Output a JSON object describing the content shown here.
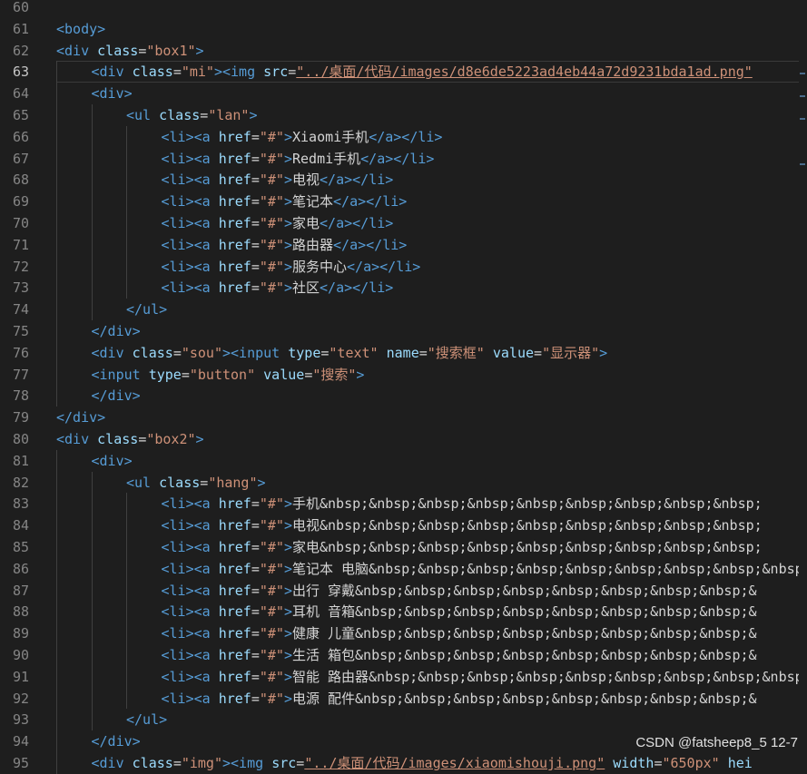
{
  "editor": {
    "first_line_number": 60,
    "current_line_number": 63,
    "lines": [
      {
        "n": "60",
        "indent": 0,
        "tokens": []
      },
      {
        "n": "61",
        "indent": 0,
        "tokens": [
          [
            "tag",
            "<body>"
          ]
        ]
      },
      {
        "n": "62",
        "indent": 0,
        "tokens": [
          [
            "tag",
            "<div "
          ],
          [
            "attr",
            "class"
          ],
          [
            "text",
            "="
          ],
          [
            "str",
            "\"box1\""
          ],
          [
            "tag",
            ">"
          ]
        ]
      },
      {
        "n": "63",
        "indent": 1,
        "tokens": [
          [
            "tag",
            "<div "
          ],
          [
            "attr",
            "class"
          ],
          [
            "text",
            "="
          ],
          [
            "str",
            "\"mi\""
          ],
          [
            "tag",
            "><img "
          ],
          [
            "attr",
            "src"
          ],
          [
            "text",
            "="
          ],
          [
            "link",
            "\"../桌面/代码/images/d8e6de5223ad4eb44a72d9231bda1ad.png\""
          ]
        ]
      },
      {
        "n": "64",
        "indent": 1,
        "tokens": [
          [
            "tag",
            "<div>"
          ]
        ]
      },
      {
        "n": "65",
        "indent": 2,
        "tokens": [
          [
            "tag",
            "<ul "
          ],
          [
            "attr",
            "class"
          ],
          [
            "text",
            "="
          ],
          [
            "str",
            "\"lan\""
          ],
          [
            "tag",
            ">"
          ]
        ]
      },
      {
        "n": "66",
        "indent": 3,
        "tokens": [
          [
            "tag",
            "<li><a "
          ],
          [
            "attr",
            "href"
          ],
          [
            "text",
            "="
          ],
          [
            "str",
            "\"#\""
          ],
          [
            "tag",
            ">"
          ],
          [
            "text",
            "Xiaomi手机"
          ],
          [
            "tag",
            "</a></li>"
          ]
        ]
      },
      {
        "n": "67",
        "indent": 3,
        "tokens": [
          [
            "tag",
            "<li><a "
          ],
          [
            "attr",
            "href"
          ],
          [
            "text",
            "="
          ],
          [
            "str",
            "\"#\""
          ],
          [
            "tag",
            ">"
          ],
          [
            "text",
            "Redmi手机"
          ],
          [
            "tag",
            "</a></li>"
          ]
        ]
      },
      {
        "n": "68",
        "indent": 3,
        "tokens": [
          [
            "tag",
            "<li><a "
          ],
          [
            "attr",
            "href"
          ],
          [
            "text",
            "="
          ],
          [
            "str",
            "\"#\""
          ],
          [
            "tag",
            ">"
          ],
          [
            "text",
            "电视"
          ],
          [
            "tag",
            "</a></li>"
          ]
        ]
      },
      {
        "n": "69",
        "indent": 3,
        "tokens": [
          [
            "tag",
            "<li><a "
          ],
          [
            "attr",
            "href"
          ],
          [
            "text",
            "="
          ],
          [
            "str",
            "\"#\""
          ],
          [
            "tag",
            ">"
          ],
          [
            "text",
            "笔记本"
          ],
          [
            "tag",
            "</a></li>"
          ]
        ]
      },
      {
        "n": "70",
        "indent": 3,
        "tokens": [
          [
            "tag",
            "<li><a "
          ],
          [
            "attr",
            "href"
          ],
          [
            "text",
            "="
          ],
          [
            "str",
            "\"#\""
          ],
          [
            "tag",
            ">"
          ],
          [
            "text",
            "家电"
          ],
          [
            "tag",
            "</a></li>"
          ]
        ]
      },
      {
        "n": "71",
        "indent": 3,
        "tokens": [
          [
            "tag",
            "<li><a "
          ],
          [
            "attr",
            "href"
          ],
          [
            "text",
            "="
          ],
          [
            "str",
            "\"#\""
          ],
          [
            "tag",
            ">"
          ],
          [
            "text",
            "路由器"
          ],
          [
            "tag",
            "</a></li>"
          ]
        ]
      },
      {
        "n": "72",
        "indent": 3,
        "tokens": [
          [
            "tag",
            "<li><a "
          ],
          [
            "attr",
            "href"
          ],
          [
            "text",
            "="
          ],
          [
            "str",
            "\"#\""
          ],
          [
            "tag",
            ">"
          ],
          [
            "text",
            "服务中心"
          ],
          [
            "tag",
            "</a></li>"
          ]
        ]
      },
      {
        "n": "73",
        "indent": 3,
        "tokens": [
          [
            "tag",
            "<li><a "
          ],
          [
            "attr",
            "href"
          ],
          [
            "text",
            "="
          ],
          [
            "str",
            "\"#\""
          ],
          [
            "tag",
            ">"
          ],
          [
            "text",
            "社区"
          ],
          [
            "tag",
            "</a></li>"
          ]
        ]
      },
      {
        "n": "74",
        "indent": 2,
        "tokens": [
          [
            "tag",
            "</ul>"
          ]
        ]
      },
      {
        "n": "75",
        "indent": 1,
        "tokens": [
          [
            "tag",
            "</div>"
          ]
        ]
      },
      {
        "n": "76",
        "indent": 1,
        "tokens": [
          [
            "tag",
            "<div "
          ],
          [
            "attr",
            "class"
          ],
          [
            "text",
            "="
          ],
          [
            "str",
            "\"sou\""
          ],
          [
            "tag",
            "><input "
          ],
          [
            "attr",
            "type"
          ],
          [
            "text",
            "="
          ],
          [
            "str",
            "\"text\""
          ],
          [
            "text",
            " "
          ],
          [
            "attr",
            "name"
          ],
          [
            "text",
            "="
          ],
          [
            "str",
            "\"搜索框\""
          ],
          [
            "text",
            " "
          ],
          [
            "attr",
            "value"
          ],
          [
            "text",
            "="
          ],
          [
            "str",
            "\"显示器\""
          ],
          [
            "tag",
            ">"
          ]
        ]
      },
      {
        "n": "77",
        "indent": 1,
        "tokens": [
          [
            "tag",
            "<input "
          ],
          [
            "attr",
            "type"
          ],
          [
            "text",
            "="
          ],
          [
            "str",
            "\"button\""
          ],
          [
            "text",
            " "
          ],
          [
            "attr",
            "value"
          ],
          [
            "text",
            "="
          ],
          [
            "str",
            "\"搜索\""
          ],
          [
            "tag",
            ">"
          ]
        ]
      },
      {
        "n": "78",
        "indent": 1,
        "tokens": [
          [
            "tag",
            "</div>"
          ]
        ]
      },
      {
        "n": "79",
        "indent": 0,
        "tokens": [
          [
            "tag",
            "</div>"
          ]
        ]
      },
      {
        "n": "80",
        "indent": 0,
        "tokens": [
          [
            "tag",
            "<div "
          ],
          [
            "attr",
            "class"
          ],
          [
            "text",
            "="
          ],
          [
            "str",
            "\"box2\""
          ],
          [
            "tag",
            ">"
          ]
        ]
      },
      {
        "n": "81",
        "indent": 1,
        "tokens": [
          [
            "tag",
            "<div>"
          ]
        ]
      },
      {
        "n": "82",
        "indent": 2,
        "tokens": [
          [
            "tag",
            "<ul "
          ],
          [
            "attr",
            "class"
          ],
          [
            "text",
            "="
          ],
          [
            "str",
            "\"hang\""
          ],
          [
            "tag",
            ">"
          ]
        ]
      },
      {
        "n": "83",
        "indent": 3,
        "tokens": [
          [
            "tag",
            "<li><a "
          ],
          [
            "attr",
            "href"
          ],
          [
            "text",
            "="
          ],
          [
            "str",
            "\"#\""
          ],
          [
            "tag",
            ">"
          ],
          [
            "text",
            "手机&nbsp;&nbsp;&nbsp;&nbsp;&nbsp;&nbsp;&nbsp;&nbsp;&nbsp;"
          ]
        ]
      },
      {
        "n": "84",
        "indent": 3,
        "tokens": [
          [
            "tag",
            "<li><a "
          ],
          [
            "attr",
            "href"
          ],
          [
            "text",
            "="
          ],
          [
            "str",
            "\"#\""
          ],
          [
            "tag",
            ">"
          ],
          [
            "text",
            "电视&nbsp;&nbsp;&nbsp;&nbsp;&nbsp;&nbsp;&nbsp;&nbsp;&nbsp;"
          ]
        ]
      },
      {
        "n": "85",
        "indent": 3,
        "tokens": [
          [
            "tag",
            "<li><a "
          ],
          [
            "attr",
            "href"
          ],
          [
            "text",
            "="
          ],
          [
            "str",
            "\"#\""
          ],
          [
            "tag",
            ">"
          ],
          [
            "text",
            "家电&nbsp;&nbsp;&nbsp;&nbsp;&nbsp;&nbsp;&nbsp;&nbsp;&nbsp;"
          ]
        ]
      },
      {
        "n": "86",
        "indent": 3,
        "tokens": [
          [
            "tag",
            "<li><a "
          ],
          [
            "attr",
            "href"
          ],
          [
            "text",
            "="
          ],
          [
            "str",
            "\"#\""
          ],
          [
            "tag",
            ">"
          ],
          [
            "text",
            "笔记本 电脑&nbsp;&nbsp;&nbsp;&nbsp;&nbsp;&nbsp;&nbsp;&nbsp;&nbsp"
          ]
        ]
      },
      {
        "n": "87",
        "indent": 3,
        "tokens": [
          [
            "tag",
            "<li><a "
          ],
          [
            "attr",
            "href"
          ],
          [
            "text",
            "="
          ],
          [
            "str",
            "\"#\""
          ],
          [
            "tag",
            ">"
          ],
          [
            "text",
            "出行 穿戴&nbsp;&nbsp;&nbsp;&nbsp;&nbsp;&nbsp;&nbsp;&nbsp;&"
          ]
        ]
      },
      {
        "n": "88",
        "indent": 3,
        "tokens": [
          [
            "tag",
            "<li><a "
          ],
          [
            "attr",
            "href"
          ],
          [
            "text",
            "="
          ],
          [
            "str",
            "\"#\""
          ],
          [
            "tag",
            ">"
          ],
          [
            "text",
            "耳机 音箱&nbsp;&nbsp;&nbsp;&nbsp;&nbsp;&nbsp;&nbsp;&nbsp;&"
          ]
        ]
      },
      {
        "n": "89",
        "indent": 3,
        "tokens": [
          [
            "tag",
            "<li><a "
          ],
          [
            "attr",
            "href"
          ],
          [
            "text",
            "="
          ],
          [
            "str",
            "\"#\""
          ],
          [
            "tag",
            ">"
          ],
          [
            "text",
            "健康 儿童&nbsp;&nbsp;&nbsp;&nbsp;&nbsp;&nbsp;&nbsp;&nbsp;&"
          ]
        ]
      },
      {
        "n": "90",
        "indent": 3,
        "tokens": [
          [
            "tag",
            "<li><a "
          ],
          [
            "attr",
            "href"
          ],
          [
            "text",
            "="
          ],
          [
            "str",
            "\"#\""
          ],
          [
            "tag",
            ">"
          ],
          [
            "text",
            "生活 箱包&nbsp;&nbsp;&nbsp;&nbsp;&nbsp;&nbsp;&nbsp;&nbsp;&"
          ]
        ]
      },
      {
        "n": "91",
        "indent": 3,
        "tokens": [
          [
            "tag",
            "<li><a "
          ],
          [
            "attr",
            "href"
          ],
          [
            "text",
            "="
          ],
          [
            "str",
            "\"#\""
          ],
          [
            "tag",
            ">"
          ],
          [
            "text",
            "智能 路由器&nbsp;&nbsp;&nbsp;&nbsp;&nbsp;&nbsp;&nbsp;&nbsp;&nbsp"
          ]
        ]
      },
      {
        "n": "92",
        "indent": 3,
        "tokens": [
          [
            "tag",
            "<li><a "
          ],
          [
            "attr",
            "href"
          ],
          [
            "text",
            "="
          ],
          [
            "str",
            "\"#\""
          ],
          [
            "tag",
            ">"
          ],
          [
            "text",
            "电源 配件&nbsp;&nbsp;&nbsp;&nbsp;&nbsp;&nbsp;&nbsp;&nbsp;&"
          ]
        ]
      },
      {
        "n": "93",
        "indent": 2,
        "tokens": [
          [
            "tag",
            "</ul>"
          ]
        ]
      },
      {
        "n": "94",
        "indent": 1,
        "tokens": [
          [
            "tag",
            "</div>"
          ]
        ]
      },
      {
        "n": "95",
        "indent": 1,
        "tokens": [
          [
            "tag",
            "<div "
          ],
          [
            "attr",
            "class"
          ],
          [
            "text",
            "="
          ],
          [
            "str",
            "\"img\""
          ],
          [
            "tag",
            "><img "
          ],
          [
            "attr",
            "src"
          ],
          [
            "text",
            "="
          ],
          [
            "link",
            "\"../桌面/代码/images/xiaomishouji.png\""
          ],
          [
            "text",
            " "
          ],
          [
            "attr",
            "width"
          ],
          [
            "text",
            "="
          ],
          [
            "str",
            "\"650px\""
          ],
          [
            "text",
            " "
          ],
          [
            "attr",
            "hei"
          ]
        ]
      }
    ]
  },
  "watermark": "CSDN @fatsheep8_5 12-7",
  "colors": {
    "background": "#1e1e1e",
    "tag": "#569cd6",
    "attr": "#9cdcfe",
    "string": "#ce9178",
    "text": "#d4d4d4",
    "line_number": "#858585"
  }
}
